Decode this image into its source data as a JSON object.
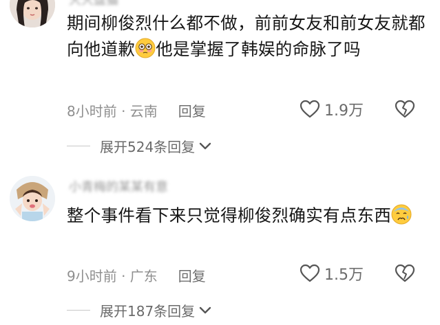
{
  "comments": [
    {
      "username": "大大盘猫",
      "text_before_emoji": "期间柳俊烈什么都不做，前前女友和前女友就都向他道歉",
      "emoji": "flushed-face",
      "text_after_emoji": "他是掌握了韩娱的命脉了吗",
      "time_location": "8小时前 · 云南",
      "reply_label": "回复",
      "likes": "1.9万",
      "expand_label": "展开524条回复"
    },
    {
      "username": "小青梅的某某有意",
      "text_before_emoji": "整个事件看下来只觉得柳俊烈确实有点东西",
      "emoji": "cold-sweat-face",
      "text_after_emoji": "",
      "time_location": "9小时前 · 广东",
      "reply_label": "回复",
      "likes": "1.5万",
      "expand_label": "展开187条回复"
    }
  ]
}
